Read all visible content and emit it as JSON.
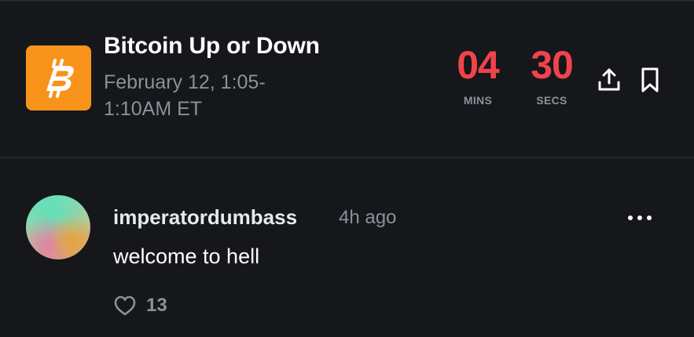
{
  "market": {
    "icon": "bitcoin-icon",
    "icon_color": "#f7931a",
    "title": "Bitcoin Up or Down",
    "date": "February 12, 1:05-1:10AM ET"
  },
  "countdown": {
    "minutes": "04",
    "minutes_label": "MINS",
    "seconds": "30",
    "seconds_label": "SECS",
    "color": "#f0434b"
  },
  "actions": {
    "share_icon": "share-icon",
    "bookmark_icon": "bookmark-icon"
  },
  "comment": {
    "username": "imperatordumbass",
    "time_ago": "4h ago",
    "text": "welcome to hell",
    "like_icon": "heart-icon",
    "likes": "13",
    "more_icon": "more-horizontal-icon"
  }
}
